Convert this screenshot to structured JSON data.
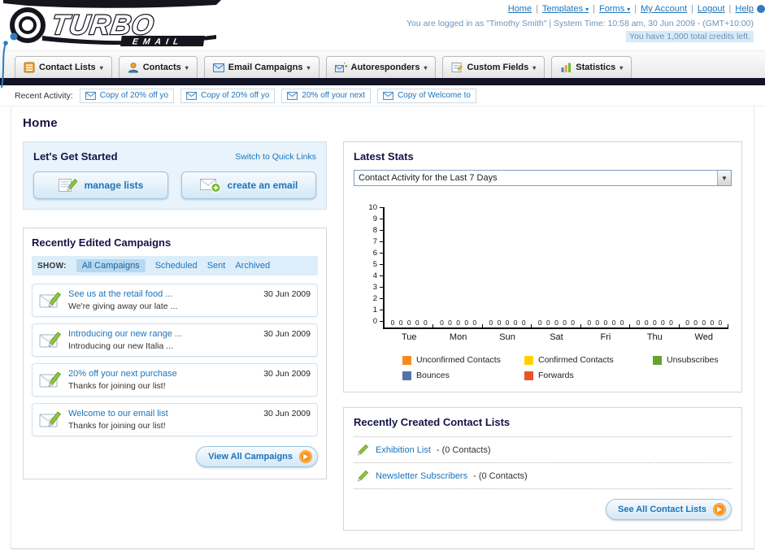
{
  "icons": {
    "chevron_down": "▾",
    "select_arrow": "▼",
    "separator": "|"
  },
  "header": {
    "logo_main": "TURBO",
    "logo_sub": "EMAIL",
    "links": [
      "Home",
      "Templates",
      "Forms",
      "My Account",
      "Logout",
      "Help"
    ],
    "status_line1": "You are logged in as \"Timothy Smith\" | System Time: 10:58 am, 30 Jun 2009 - (GMT+10:00)",
    "status_line2": "You have 1,000 total credits left."
  },
  "nav": {
    "tabs": [
      {
        "label": "Contact Lists"
      },
      {
        "label": "Contacts"
      },
      {
        "label": "Email Campaigns"
      },
      {
        "label": "Autoresponders"
      },
      {
        "label": "Custom Fields"
      },
      {
        "label": "Statistics"
      }
    ]
  },
  "recent_activity": {
    "label": "Recent Activity:",
    "items": [
      "Copy of 20% off yo",
      "Copy of 20% off yo",
      "20% off your next",
      "Copy of Welcome to"
    ]
  },
  "page": {
    "title": "Home"
  },
  "get_started": {
    "title": "Let's Get Started",
    "switch_link": "Switch to Quick Links",
    "manage_lists_label": "manage lists",
    "create_email_label": "create an email"
  },
  "campaigns": {
    "title": "Recently Edited Campaigns",
    "show_label": "SHOW:",
    "filters": [
      "All Campaigns",
      "Scheduled",
      "Sent",
      "Archived"
    ],
    "active_filter": "All Campaigns",
    "items": [
      {
        "title": "See us at the retail food ...",
        "subtitle": "We're giving away our late ...",
        "date": "30 Jun 2009"
      },
      {
        "title": "Introducing our new range ...",
        "subtitle": "Introducing our new Italia ...",
        "date": "30 Jun 2009"
      },
      {
        "title": "20% off your next purchase",
        "subtitle": "Thanks for joining our list!",
        "date": "30 Jun 2009"
      },
      {
        "title": "Welcome to our email list",
        "subtitle": "Thanks for joining our list!",
        "date": "30 Jun 2009"
      }
    ],
    "view_all_label": "View All Campaigns"
  },
  "stats": {
    "title": "Latest Stats",
    "dropdown_value": "Contact Activity for the Last 7 Days",
    "chart_data": {
      "type": "bar",
      "title": "Contact Activity for the Last 7 Days",
      "categories": [
        "Tue",
        "Mon",
        "Sun",
        "Sat",
        "Fri",
        "Thu",
        "Wed"
      ],
      "series": [
        {
          "name": "Unconfirmed Contacts",
          "color": "#F68C1D",
          "values": [
            0,
            0,
            0,
            0,
            0,
            0,
            0
          ]
        },
        {
          "name": "Confirmed Contacts",
          "color": "#FFD200",
          "values": [
            0,
            0,
            0,
            0,
            0,
            0,
            0
          ]
        },
        {
          "name": "Unsubscribes",
          "color": "#66A52B",
          "values": [
            0,
            0,
            0,
            0,
            0,
            0,
            0
          ]
        },
        {
          "name": "Bounces",
          "color": "#5472A8",
          "values": [
            0,
            0,
            0,
            0,
            0,
            0,
            0
          ]
        },
        {
          "name": "Forwards",
          "color": "#E85426",
          "values": [
            0,
            0,
            0,
            0,
            0,
            0,
            0
          ]
        }
      ],
      "ylim": [
        0,
        10
      ],
      "xlabel": "",
      "ylabel": "",
      "grid": false,
      "legend_position": "bottom"
    }
  },
  "contact_lists": {
    "title": "Recently Created Contact Lists",
    "items": [
      {
        "name": "Exhibition List",
        "suffix": "- (0 Contacts)"
      },
      {
        "name": "Newsletter Subscribers",
        "suffix": "- (0 Contacts)"
      }
    ],
    "see_all_label": "See All Contact Lists"
  }
}
